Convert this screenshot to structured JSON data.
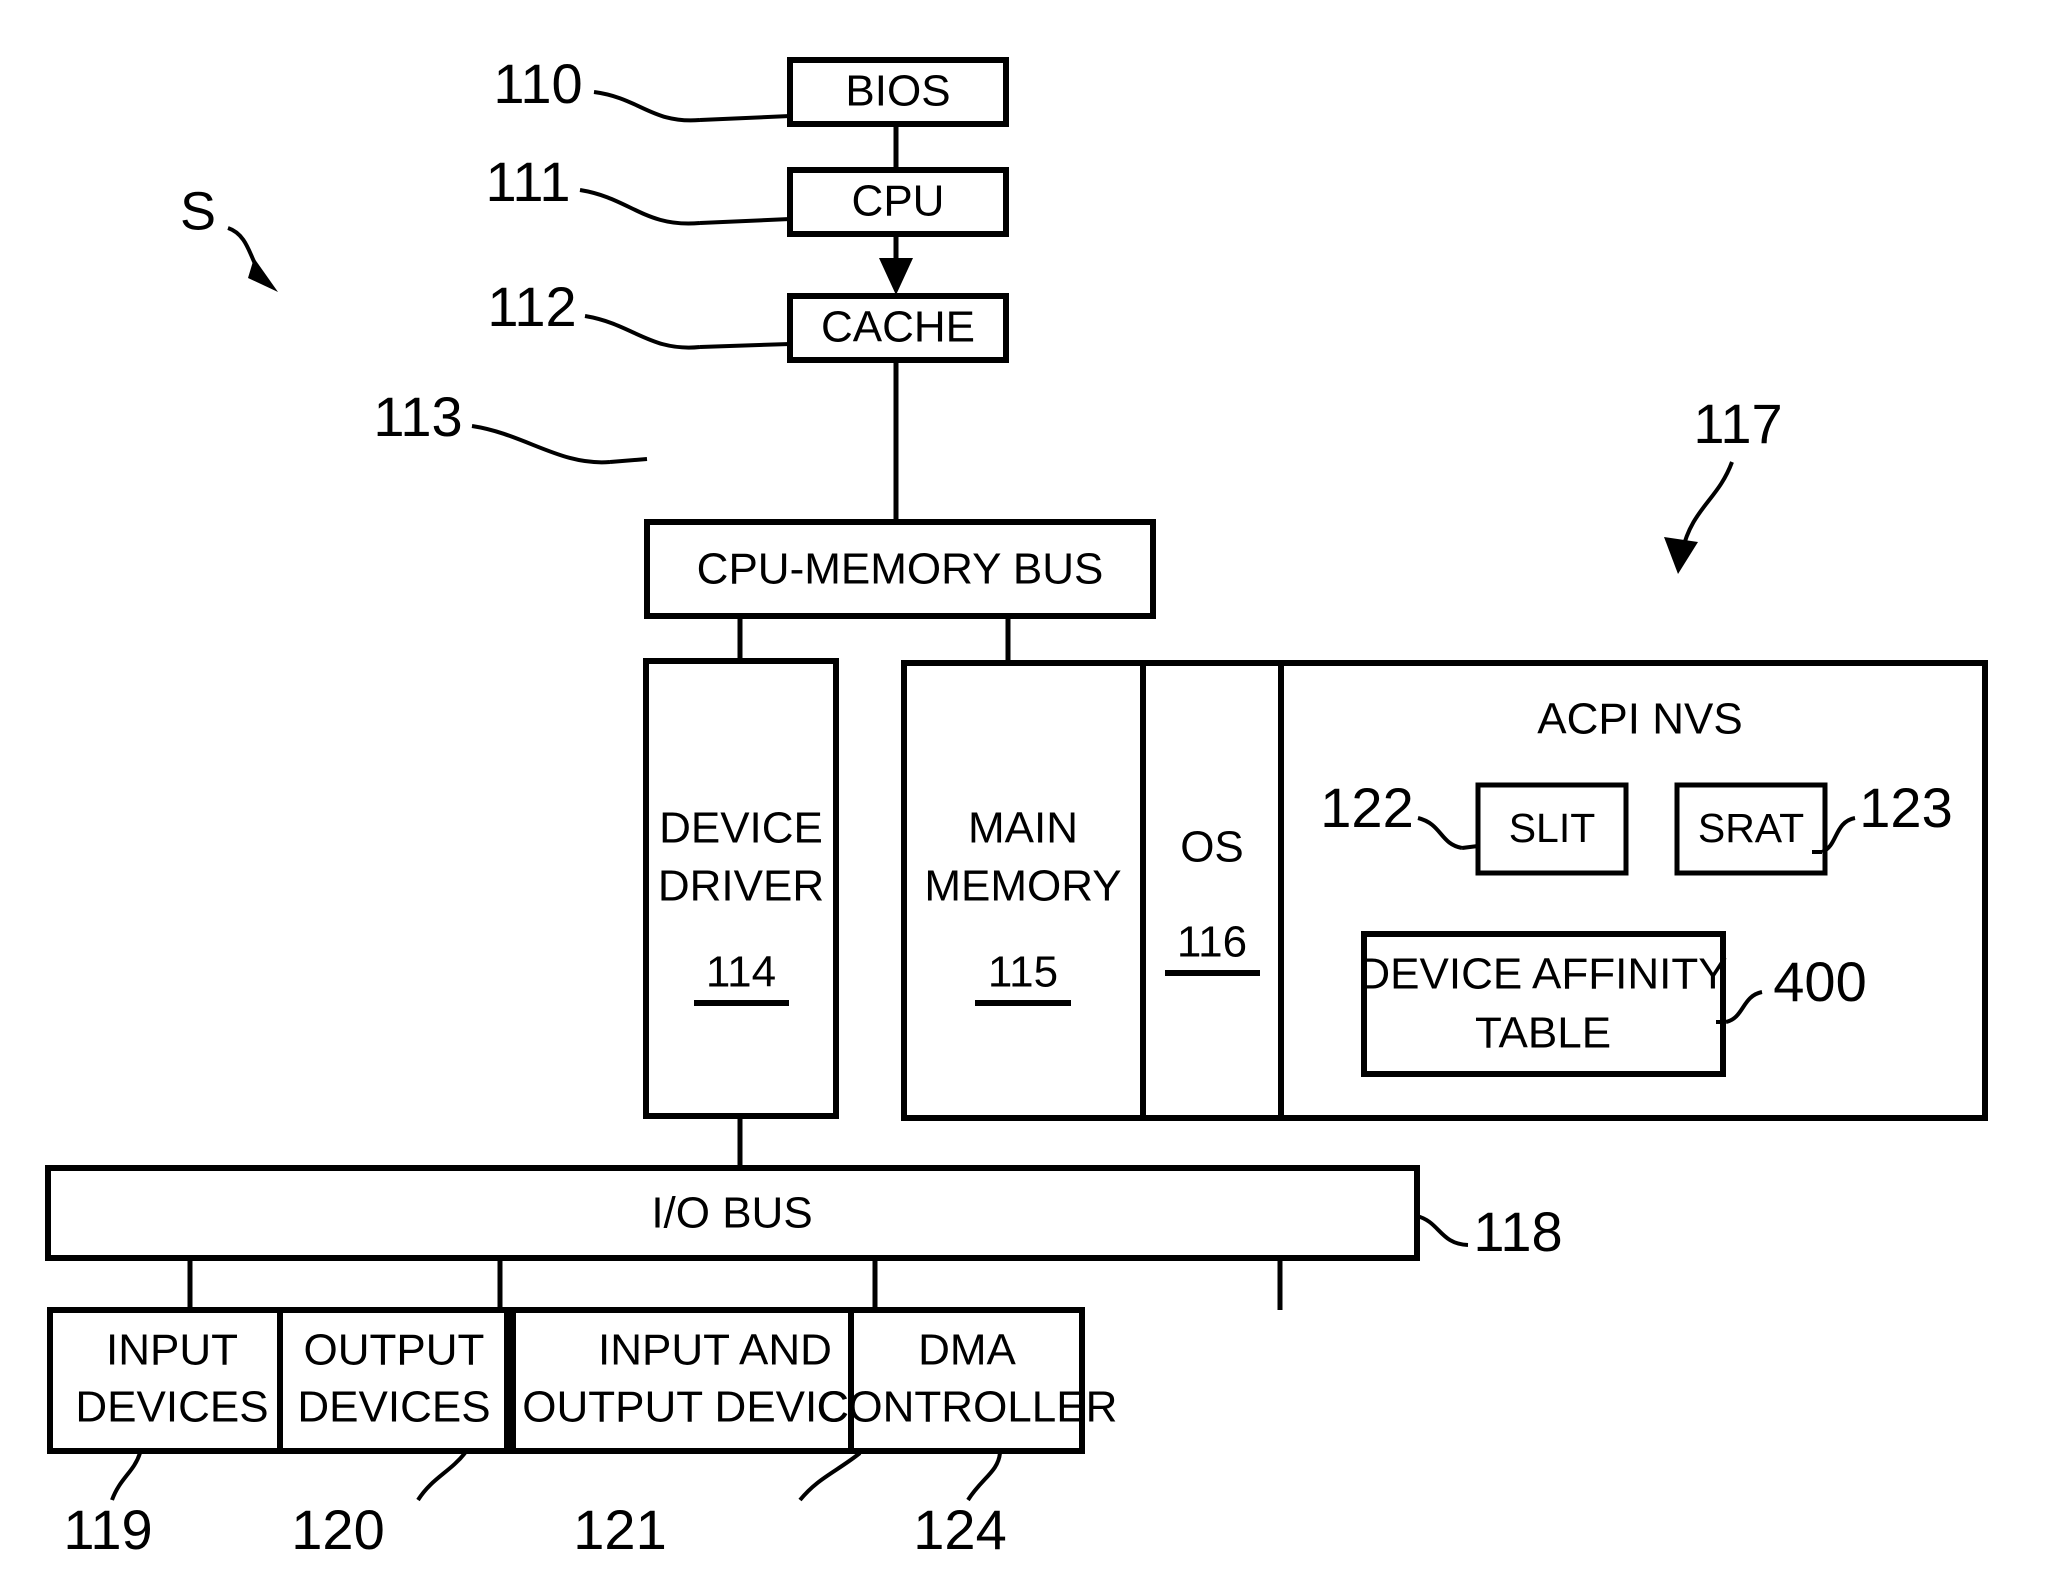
{
  "figure": {
    "system_marker": "S",
    "blocks": {
      "bios": {
        "label": "BIOS",
        "ref": "110"
      },
      "cpu": {
        "label": "CPU",
        "ref": "111"
      },
      "cache": {
        "label": "CACHE",
        "ref": "112"
      },
      "cpu_memory_bus": {
        "label": "CPU-MEMORY BUS",
        "ref": "113"
      },
      "device_driver": {
        "label_line1": "DEVICE",
        "label_line2": "DRIVER",
        "ref": "114"
      },
      "main_memory": {
        "label_line1": "MAIN",
        "label_line2": "MEMORY",
        "ref": "115"
      },
      "os": {
        "label": "OS",
        "ref": "116"
      },
      "acpi_nvs": {
        "label": "ACPI NVS",
        "ref": "117"
      },
      "slit": {
        "label": "SLIT",
        "ref": "122"
      },
      "srat": {
        "label": "SRAT",
        "ref": "123"
      },
      "device_affinity_table": {
        "label_line1": "DEVICE AFFINITY",
        "label_line2": "TABLE",
        "ref": "400"
      },
      "io_bus": {
        "label": "I/O BUS",
        "ref": "118"
      },
      "input_devices": {
        "label_line1": "INPUT",
        "label_line2": "DEVICES",
        "ref": "119"
      },
      "output_devices": {
        "label_line1": "OUTPUT",
        "label_line2": "DEVICES",
        "ref": "120"
      },
      "input_and_output_devices": {
        "label_line1": "INPUT AND",
        "label_line2": "OUTPUT DEVICES",
        "ref": "121"
      },
      "dma_controller": {
        "label_line1": "DMA",
        "label_line2": "CONTROLLER",
        "ref": "124"
      }
    },
    "colors": {
      "stroke": "#000000",
      "fill": "#ffffff"
    }
  }
}
